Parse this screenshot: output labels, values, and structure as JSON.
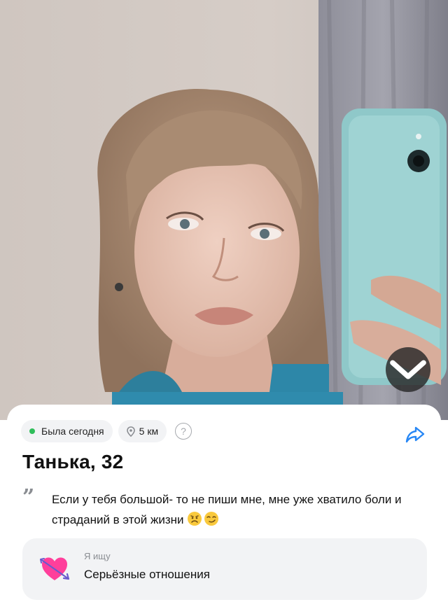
{
  "status": {
    "online_text": "Была сегодня",
    "online_color": "#2fbd5a",
    "distance_text": "5 км",
    "help_glyph": "?"
  },
  "profile": {
    "name_age": "Танька, 32",
    "bio": "Если у тебя большой- то не пиши мне, мне уже хватило боли и страданий в этой жизни",
    "bio_emojis": [
      "worried-face",
      "smirking-face"
    ]
  },
  "looking_for": {
    "label": "Я ищу",
    "value": "Серьёзные отношения",
    "icon": "heart-with-arrow-icon"
  },
  "icons": {
    "expand": "chevron-down-icon",
    "share": "share-arrow-icon",
    "location": "location-pin-icon",
    "help": "question-circle-icon"
  },
  "colors": {
    "accent": "#2787f5",
    "chip_bg": "#f2f3f5",
    "muted_text": "#8a8d92"
  }
}
